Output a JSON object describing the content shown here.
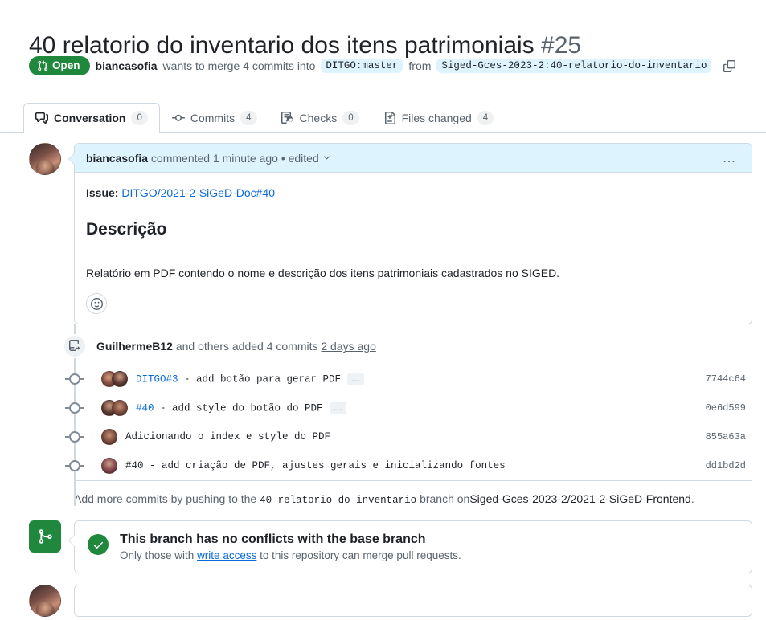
{
  "pull_request": {
    "title": "40 relatorio do inventario dos itens patrimoniais",
    "number": "#25",
    "state_label": "Open",
    "state_color": "#1f883d",
    "author": "biancasofia",
    "merge_phrase_1": "wants to merge 4 commits into",
    "base_branch": "DITGO:master",
    "merge_phrase_2": "from",
    "head_branch": "Siged-Gces-2023-2:40-relatorio-do-inventario",
    "copy_icon": "copy-icon"
  },
  "tabs": [
    {
      "label": "Conversation",
      "count": "0",
      "icon": "comment-discussion-icon",
      "active": true
    },
    {
      "label": "Commits",
      "count": "4",
      "icon": "git-commit-icon",
      "active": false
    },
    {
      "label": "Checks",
      "count": "0",
      "icon": "checklist-icon",
      "active": false
    },
    {
      "label": "Files changed",
      "count": "4",
      "icon": "file-diff-icon",
      "active": false
    }
  ],
  "comment": {
    "author": "biancasofia",
    "action": "commented",
    "timestamp": "1 minute ago",
    "separator": "•",
    "edited_label": "edited",
    "kebab_label": "…",
    "issue_label": "Issue:",
    "issue_link": "DITGO/2021-2-SiGeD-Doc#40",
    "heading": "Descrição",
    "body": "Relatório em PDF contendo o nome e descrição dos itens patrimoniais cadastrados no SIGED.",
    "reaction_icon": "smiley-icon"
  },
  "commits_event": {
    "icon": "repo-push-icon",
    "actor": "GuilhermeB12",
    "text_middle": "and others added 4 commits",
    "time_link": "2 days ago",
    "commits": [
      {
        "prefix": "DITGO#3",
        "message": " - add botão para gerar PDF",
        "has_expand": true,
        "expand_label": "…",
        "sha": "7744c64",
        "avatars": 2
      },
      {
        "prefix": "#40",
        "message": " - add style do botão do PDF",
        "has_expand": true,
        "expand_label": "…",
        "sha": "0e6d599",
        "avatars": 2
      },
      {
        "prefix": "",
        "message": "Adicionando o index e style do PDF",
        "has_expand": false,
        "expand_label": "",
        "sha": "855a63a",
        "avatars": 1
      },
      {
        "prefix": "",
        "message": "#40 - add criação de PDF, ajustes gerais e inicializando fontes",
        "has_expand": false,
        "expand_label": "",
        "sha": "dd1bd2d",
        "avatars": 1
      }
    ],
    "footer_pre": "Add more commits by pushing to the",
    "footer_branch": "40-relatorio-do-inventario",
    "footer_mid": "branch on",
    "footer_repo": "Siged-Gces-2023-2/2021-2-SiGeD-Frontend",
    "footer_end": "."
  },
  "merge_status": {
    "icon": "git-merge-icon",
    "icon_bg": "#1f883d",
    "check_icon": "check-icon",
    "title": "This branch has no conflicts with the base branch",
    "subtitle_pre": "Only those with",
    "subtitle_link": "write access",
    "subtitle_post": "to this repository can merge pull requests."
  }
}
